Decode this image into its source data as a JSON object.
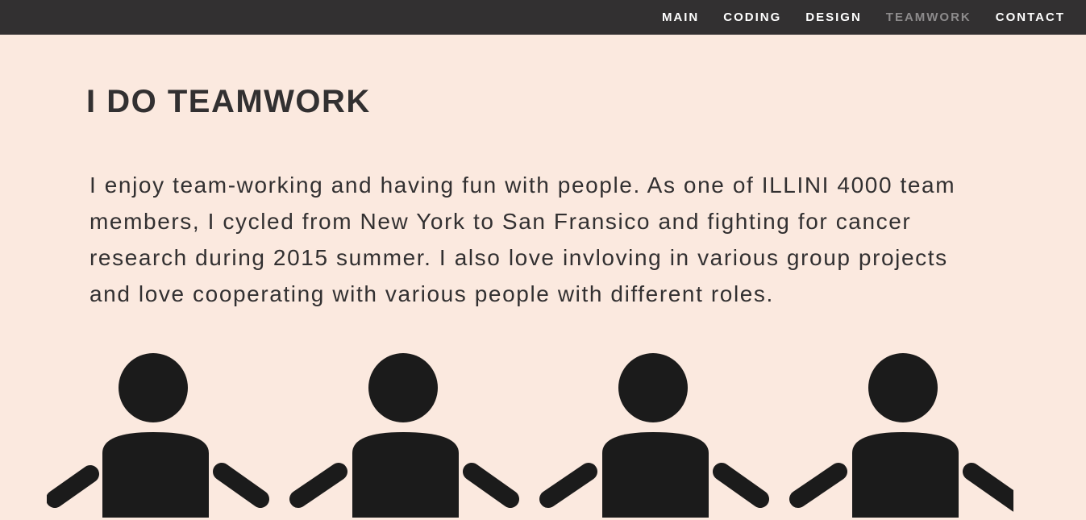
{
  "nav": {
    "items": [
      {
        "label": "MAIN"
      },
      {
        "label": "CODING"
      },
      {
        "label": "DESIGN"
      },
      {
        "label": "TEAMWORK",
        "active": true
      },
      {
        "label": "CONTACT"
      }
    ]
  },
  "main": {
    "heading": "I DO TEAMWORK",
    "paragraph": "I enjoy team-working and having fun with people. As one of ILLINI 4000 team members, I cycled from New York to San Fransico and fighting for cancer research during 2015 summer. I also love invloving in various group projects and love cooperating with various people with different roles."
  },
  "illustration": {
    "icon": "people-holding-hands-icon",
    "people_count": 4
  },
  "colors": {
    "background": "#fbe9df",
    "navbar": "#323031",
    "nav_text": "#ffffff",
    "nav_active": "#8d8b8c",
    "text": "#323031",
    "figure": "#1b1b1b"
  }
}
